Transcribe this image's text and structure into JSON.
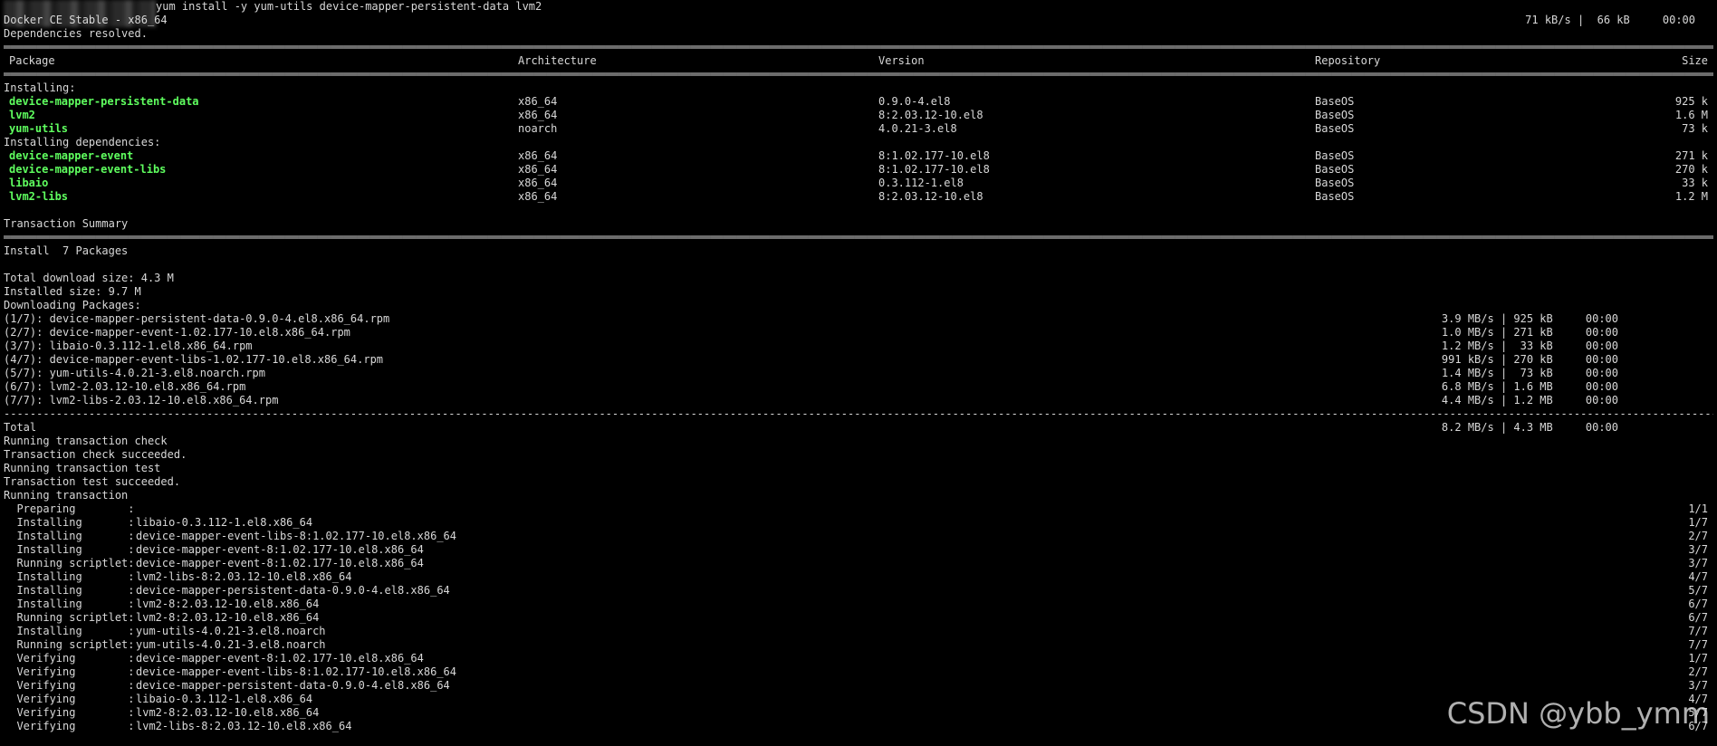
{
  "cmd": {
    "prompt_blurred": "████████████████",
    "text": "yum install -y yum-utils device-mapper-persistent-data lvm2"
  },
  "repo_line": {
    "name": "Docker CE Stable - x86_64",
    "rate": "71 kB/s |  66 kB     00:00"
  },
  "deps_resolved": "Dependencies resolved.",
  "table_headers": {
    "package": "Package",
    "arch": "Architecture",
    "version": "Version",
    "repo": "Repository",
    "size": "Size"
  },
  "installing_label": "Installing:",
  "installing": [
    {
      "name": "device-mapper-persistent-data",
      "arch": "x86_64",
      "version": "0.9.0-4.el8",
      "repo": "BaseOS",
      "size": "925 k"
    },
    {
      "name": "lvm2",
      "arch": "x86_64",
      "version": "8:2.03.12-10.el8",
      "repo": "BaseOS",
      "size": "1.6 M"
    },
    {
      "name": "yum-utils",
      "arch": "noarch",
      "version": "4.0.21-3.el8",
      "repo": "BaseOS",
      "size": "73 k"
    }
  ],
  "deps_label": "Installing dependencies:",
  "deps": [
    {
      "name": "device-mapper-event",
      "arch": "x86_64",
      "version": "8:1.02.177-10.el8",
      "repo": "BaseOS",
      "size": "271 k"
    },
    {
      "name": "device-mapper-event-libs",
      "arch": "x86_64",
      "version": "8:1.02.177-10.el8",
      "repo": "BaseOS",
      "size": "270 k"
    },
    {
      "name": "libaio",
      "arch": "x86_64",
      "version": "0.3.112-1.el8",
      "repo": "BaseOS",
      "size": "33 k"
    },
    {
      "name": "lvm2-libs",
      "arch": "x86_64",
      "version": "8:2.03.12-10.el8",
      "repo": "BaseOS",
      "size": "1.2 M"
    }
  ],
  "summary_title": "Transaction Summary",
  "install_count": "Install  7 Packages",
  "total_download": "Total download size: 4.3 M",
  "installed_size": "Installed size: 9.7 M",
  "downloading": "Downloading Packages:",
  "downloads": [
    {
      "file": "(1/7): device-mapper-persistent-data-0.9.0-4.el8.x86_64.rpm",
      "stats": "3.9 MB/s | 925 kB     00:00"
    },
    {
      "file": "(2/7): device-mapper-event-1.02.177-10.el8.x86_64.rpm",
      "stats": "1.0 MB/s | 271 kB     00:00"
    },
    {
      "file": "(3/7): libaio-0.3.112-1.el8.x86_64.rpm",
      "stats": "1.2 MB/s |  33 kB     00:00"
    },
    {
      "file": "(4/7): device-mapper-event-libs-1.02.177-10.el8.x86_64.rpm",
      "stats": "991 kB/s | 270 kB     00:00"
    },
    {
      "file": "(5/7): yum-utils-4.0.21-3.el8.noarch.rpm",
      "stats": "1.4 MB/s |  73 kB     00:00"
    },
    {
      "file": "(6/7): lvm2-2.03.12-10.el8.x86_64.rpm",
      "stats": "6.8 MB/s | 1.6 MB     00:00"
    },
    {
      "file": "(7/7): lvm2-libs-2.03.12-10.el8.x86_64.rpm",
      "stats": "4.4 MB/s | 1.2 MB     00:00"
    }
  ],
  "total": {
    "label": "Total",
    "stats": "8.2 MB/s | 4.3 MB     00:00"
  },
  "status_lines": [
    "Running transaction check",
    "Transaction check succeeded.",
    "Running transaction test",
    "Transaction test succeeded.",
    "Running transaction"
  ],
  "steps": [
    {
      "action": "  Preparing        :",
      "pkg": "",
      "count": "1/1"
    },
    {
      "action": "  Installing       :",
      "pkg": "libaio-0.3.112-1.el8.x86_64",
      "count": "1/7"
    },
    {
      "action": "  Installing       :",
      "pkg": "device-mapper-event-libs-8:1.02.177-10.el8.x86_64",
      "count": "2/7"
    },
    {
      "action": "  Installing       :",
      "pkg": "device-mapper-event-8:1.02.177-10.el8.x86_64",
      "count": "3/7"
    },
    {
      "action": "  Running scriptlet:",
      "pkg": "device-mapper-event-8:1.02.177-10.el8.x86_64",
      "count": "3/7"
    },
    {
      "action": "  Installing       :",
      "pkg": "lvm2-libs-8:2.03.12-10.el8.x86_64",
      "count": "4/7"
    },
    {
      "action": "  Installing       :",
      "pkg": "device-mapper-persistent-data-0.9.0-4.el8.x86_64",
      "count": "5/7"
    },
    {
      "action": "  Installing       :",
      "pkg": "lvm2-8:2.03.12-10.el8.x86_64",
      "count": "6/7"
    },
    {
      "action": "  Running scriptlet:",
      "pkg": "lvm2-8:2.03.12-10.el8.x86_64",
      "count": "6/7"
    },
    {
      "action": "  Installing       :",
      "pkg": "yum-utils-4.0.21-3.el8.noarch",
      "count": "7/7"
    },
    {
      "action": "  Running scriptlet:",
      "pkg": "yum-utils-4.0.21-3.el8.noarch",
      "count": "7/7"
    },
    {
      "action": "  Verifying        :",
      "pkg": "device-mapper-event-8:1.02.177-10.el8.x86_64",
      "count": "1/7"
    },
    {
      "action": "  Verifying        :",
      "pkg": "device-mapper-event-libs-8:1.02.177-10.el8.x86_64",
      "count": "2/7"
    },
    {
      "action": "  Verifying        :",
      "pkg": "device-mapper-persistent-data-0.9.0-4.el8.x86_64",
      "count": "3/7"
    },
    {
      "action": "  Verifying        :",
      "pkg": "libaio-0.3.112-1.el8.x86_64",
      "count": "4/7"
    },
    {
      "action": "  Verifying        :",
      "pkg": "lvm2-8:2.03.12-10.el8.x86_64",
      "count": "5/7"
    },
    {
      "action": "  Verifying        :",
      "pkg": "lvm2-libs-8:2.03.12-10.el8.x86_64",
      "count": "6/7"
    }
  ],
  "watermark": "CSDN @ybb_ymm",
  "colors": {
    "background": "#000000",
    "text": "#d8d8d8",
    "package_name": "#5fff5f"
  }
}
